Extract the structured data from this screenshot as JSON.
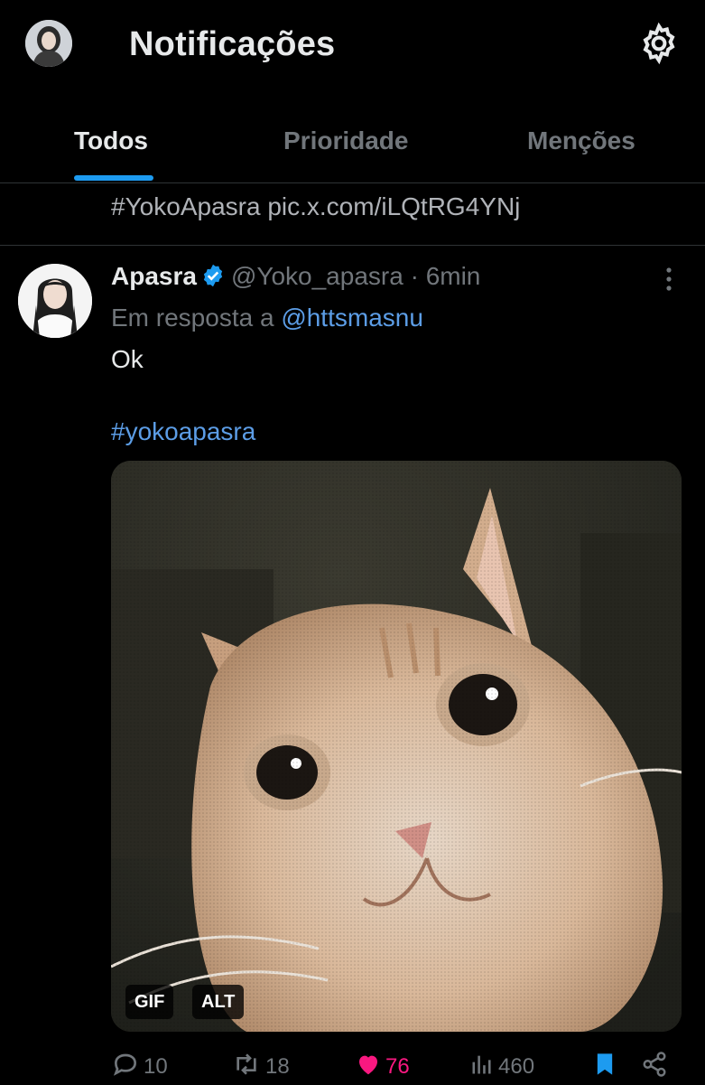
{
  "header": {
    "title": "Notificações",
    "settings_icon": "gear-icon"
  },
  "tabs": [
    {
      "label": "Todos",
      "active": true
    },
    {
      "label": "Prioridade",
      "active": false
    },
    {
      "label": "Menções",
      "active": false
    }
  ],
  "previous_tweet": {
    "text": "#YokoApasra pic.x.com/iLQtRG4YNj"
  },
  "tweet": {
    "display_name": "Apasra",
    "handle": "@Yoko_apasra",
    "separator": "·",
    "time": "6min",
    "reply_prefix": "Em resposta a",
    "reply_to": "@httsmasnu",
    "text": "Ok",
    "hashtag": "#yokoapasra",
    "media": {
      "gif_badge": "GIF",
      "alt_badge": "ALT"
    },
    "actions": {
      "replies": "10",
      "reposts": "18",
      "likes": "76",
      "views": "460"
    }
  },
  "colors": {
    "background": "#000000",
    "accent": "#1d9bf0",
    "link": "#5c9de6",
    "like": "#f91880",
    "muted": "#71767b"
  }
}
